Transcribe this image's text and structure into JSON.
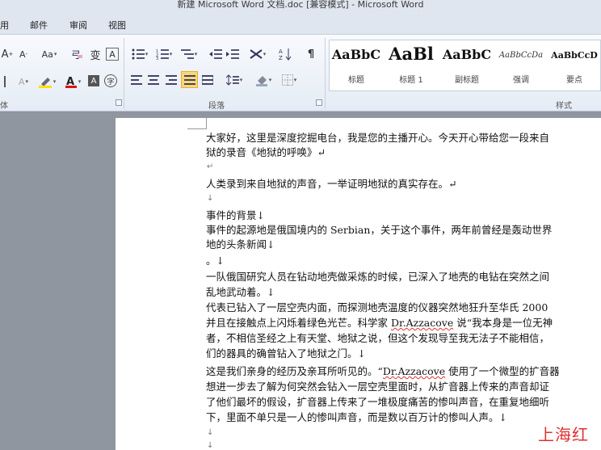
{
  "window": {
    "title": "新建 Microsoft Word 文档.doc [兼容模式] - Microsoft Word"
  },
  "menu": {
    "tabs": [
      "用",
      "邮件",
      "审阅",
      "视图"
    ]
  },
  "ribbon": {
    "font_group_label": "体",
    "paragraph_group_label": "段落",
    "styles_group_label": "样式",
    "font_buttons": {
      "grow": "A",
      "shrink": "A",
      "case": "Aa",
      "wen": "变",
      "border_char": "A",
      "highlight": "A",
      "color": "A",
      "shade_char": "A",
      "enclose": "字"
    },
    "styles": [
      {
        "sample": "AaBbC",
        "name": "标题"
      },
      {
        "sample": "AaBl",
        "name": "标题 1"
      },
      {
        "sample": "AaBbC",
        "name": "副标题"
      },
      {
        "sample": "AaBbCcDa",
        "name": "强调"
      },
      {
        "sample": "AaBbCcD",
        "name": "要点"
      }
    ]
  },
  "document": {
    "lines": [
      "大家好，这里是深度挖掘电台，我是您的主播开心。今天开心带给您一段来自",
      "狱的录音《地狱的呼唤》↵",
      "人类录到来自地狱的声音，一举证明地狱的真实存在。↵",
      "事件的背景↓",
      "事件的起源地是俄国境内的 Serbian，关于这个事件，两年前曾经是轰动世界",
      "地的头条新闻↓",
      "。↓",
      "一队俄国研究人员在钻动地壳做采炼的时候，已深入了地壳的电钻在突然之间",
      "乱地武动着。↓",
      "代表已钻入了一层空壳内面，而探测地壳温度的仪器突然地狂升至华氏 2000",
      "并且在接触点上闪烁着绿色光芒。科学家",
      "Dr.Azzacove",
      " 说“我本身是一位无神",
      "者，不相信圣经之上有天堂、地狱之说，但这个发现导至我无法子不能相信，",
      "们的器具的确曾钻入了地狱之门。↓",
      "这是我们亲身的经历及亲耳所听见的。“",
      "使用了一个微型的扩音器",
      "想进一步去了解为何突然会钻入一层空壳里面时，从扩音器上传来的声音却证",
      "了他们最坏的假设，扩音器上传来了一堆极度痛苦的惨叫声音，在重复地细听",
      "下，里面不单只是一人的惨叫声音，而是数以百万计的惨叫人声。↓"
    ],
    "marks": [
      "↵",
      "↓",
      "↓",
      "↓",
      "↓"
    ]
  },
  "watermark": "上海红网"
}
